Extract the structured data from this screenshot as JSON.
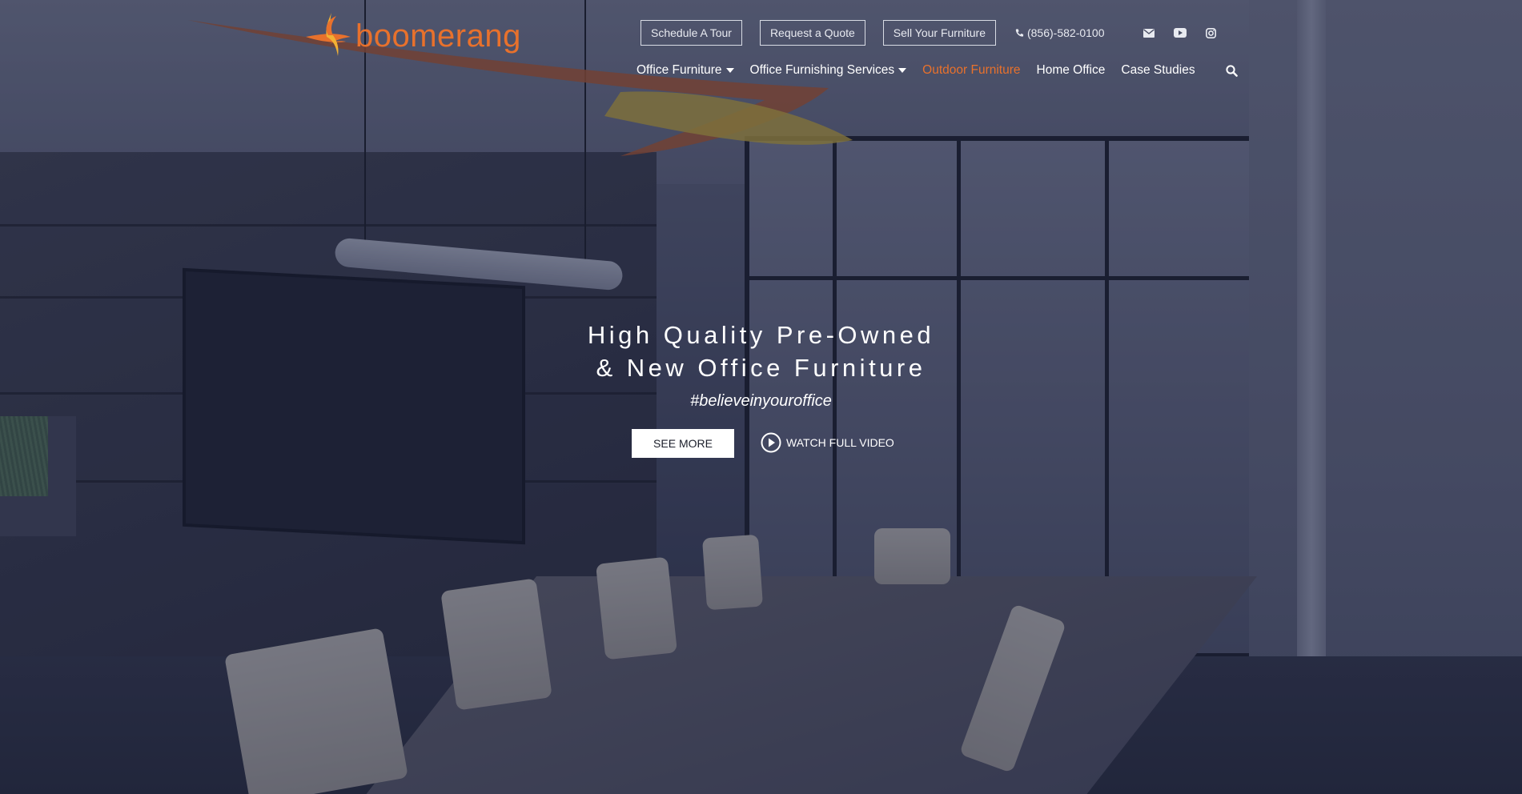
{
  "brand": {
    "name": "boomerang",
    "accent": "#e8712c"
  },
  "header": {
    "buttons": [
      "Schedule A Tour",
      "Request a Quote",
      "Sell Your Furniture"
    ],
    "phone": "(856)-582-0100",
    "social": [
      {
        "icon": "envelope-icon"
      },
      {
        "icon": "youtube-icon"
      },
      {
        "icon": "instagram-icon"
      }
    ]
  },
  "nav": {
    "items": [
      {
        "label": "Office Furniture",
        "dropdown": true
      },
      {
        "label": "Office Furnishing Services",
        "dropdown": true
      },
      {
        "label": "Outdoor Furniture",
        "active": true
      },
      {
        "label": "Home Office"
      },
      {
        "label": "Case Studies"
      }
    ],
    "search_icon": "search-icon"
  },
  "hero": {
    "headline_line1": "High Quality Pre-Owned",
    "headline_line2": "& New Office Furniture",
    "tagline": "#believeinyouroffice",
    "cta_primary": "SEE MORE",
    "cta_video": "WATCH FULL VIDEO"
  },
  "colors": {
    "overlay": "#1a203e",
    "text": "#ffffff"
  }
}
